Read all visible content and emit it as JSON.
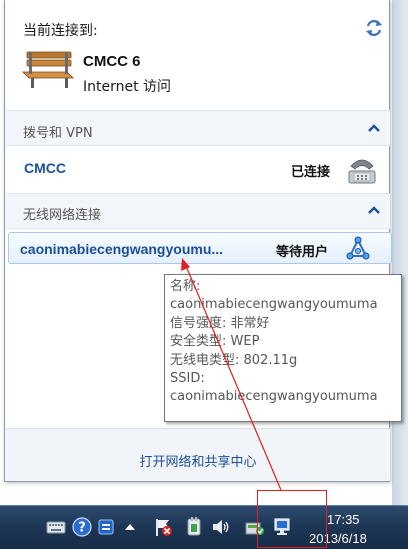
{
  "current": {
    "header": "当前连接到:",
    "network_name": "CMCC  6",
    "access": "Internet 访问"
  },
  "dialup": {
    "section_label": "拨号和 VPN",
    "name": "CMCC",
    "status": "已连接"
  },
  "wireless": {
    "section_label": "无线网络连接",
    "name": "caonimabiecengwangyoumu...",
    "status": "等待用户"
  },
  "tooltip": {
    "lines": [
      "名称:",
      "caonimabiecengwangyoumuma",
      "信号强度: 非常好",
      "安全类型: WEP",
      "无线电类型: 802.11g",
      "SSID:",
      "caonimabiecengwangyoumuma"
    ]
  },
  "footer": {
    "link": "打开网络和共享中心"
  },
  "taskbar": {
    "time": "17:35",
    "date": "2013/6/18"
  },
  "colors": {
    "link_blue": "#1b4f9a",
    "annotation_red": "#e02020",
    "taskbar": "#1e3756"
  }
}
